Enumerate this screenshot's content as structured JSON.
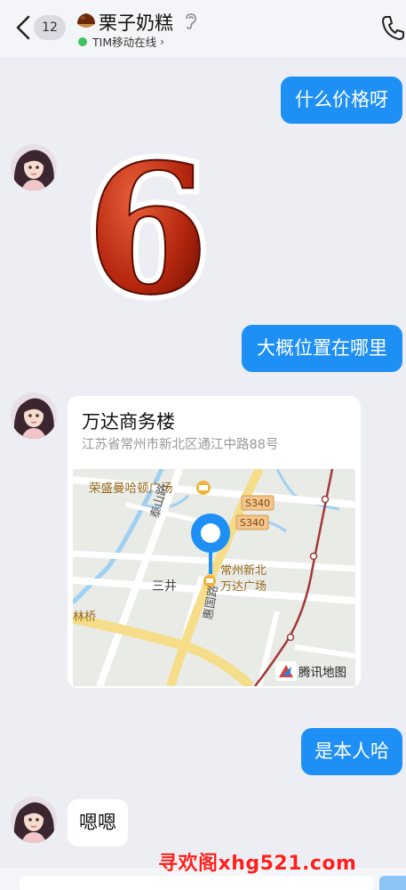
{
  "header": {
    "unread_count": "12",
    "contact_name": "栗子奶糕",
    "status_text": "TIM移动在线"
  },
  "messages": {
    "m1_out": "什么价格呀",
    "m2_sticker": "6",
    "m3_out": "大概位置在哪里",
    "m4_location": {
      "name": "万达商务楼",
      "address": "江苏省常州市新北区通江中路88号",
      "map_labels": {
        "poi1": "荣盛曼哈顿广场",
        "road_taishan": "泰山路",
        "road_s340_a": "S340",
        "road_s340_b": "S340",
        "poi2_line1": "常州新北",
        "poi2_line2": "万达广场",
        "area_sanjing": "三井",
        "area_linqiao": "林桥",
        "road_huiguo": "惠国路",
        "map_provider": "腾讯地图"
      }
    },
    "m5_out": "是本人哈",
    "m6_in": "嗯嗯"
  },
  "watermark": "寻欢阁xhg521.com",
  "colors": {
    "accent": "#1e8ff5",
    "background": "#eceef3",
    "online": "#3fc25e"
  }
}
